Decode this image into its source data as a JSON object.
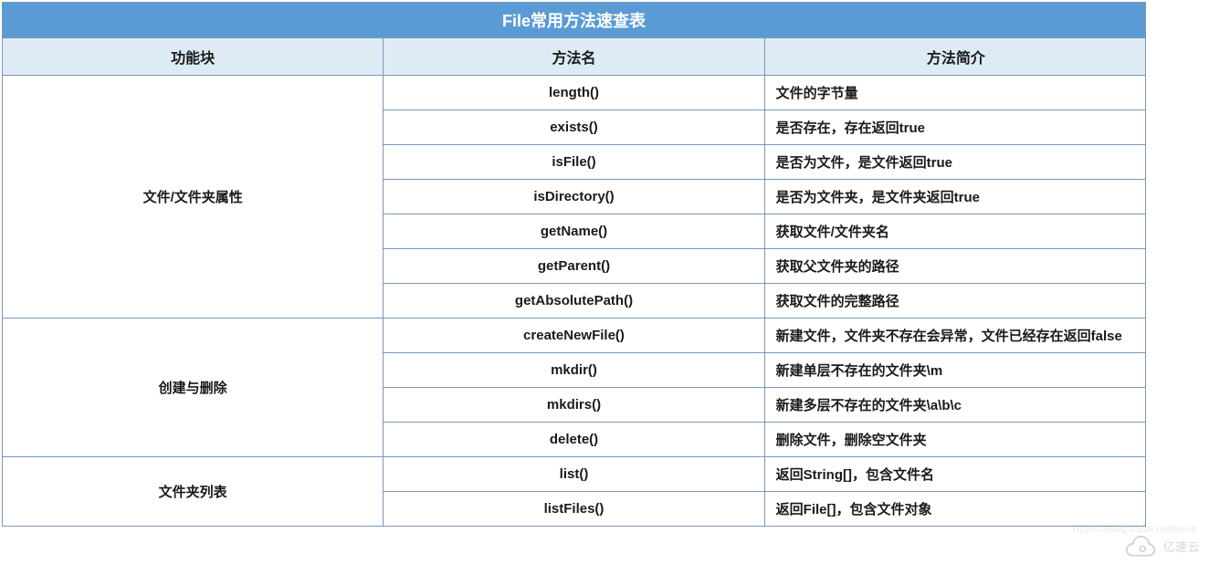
{
  "title": "File常用方法速查表",
  "headers": {
    "col1": "功能块",
    "col2": "方法名",
    "col3": "方法简介"
  },
  "sections": [
    {
      "group": "文件/文件夹属性",
      "rows": [
        {
          "method": "length()",
          "desc": "文件的字节量"
        },
        {
          "method": "exists()",
          "desc": "是否存在，存在返回true"
        },
        {
          "method": "isFile()",
          "desc": "是否为文件，是文件返回true"
        },
        {
          "method": "isDirectory()",
          "desc": "是否为文件夹，是文件夹返回true"
        },
        {
          "method": "getName()",
          "desc": "获取文件/文件夹名"
        },
        {
          "method": "getParent()",
          "desc": "获取父文件夹的路径"
        },
        {
          "method": "getAbsolutePath()",
          "desc": "获取文件的完整路径"
        }
      ]
    },
    {
      "group": "创建与删除",
      "rows": [
        {
          "method": "createNewFile()",
          "desc": "新建文件，文件夹不存在会异常，文件已经存在返回false"
        },
        {
          "method": "mkdir()",
          "desc": "新建单层不存在的文件夹\\m"
        },
        {
          "method": "mkdirs()",
          "desc": "新建多层不存在的文件夹\\a\\b\\c"
        },
        {
          "method": "delete()",
          "desc": "删除文件，删除空文件夹"
        }
      ]
    },
    {
      "group": "文件夹列表",
      "rows": [
        {
          "method": "list()",
          "desc": "返回String[]，包含文件名"
        },
        {
          "method": "listFiles()",
          "desc": "返回File[]，包含文件对象"
        }
      ]
    }
  ],
  "watermark": "亿速云",
  "blog_watermark": "https://blog.csdn.net/weix"
}
